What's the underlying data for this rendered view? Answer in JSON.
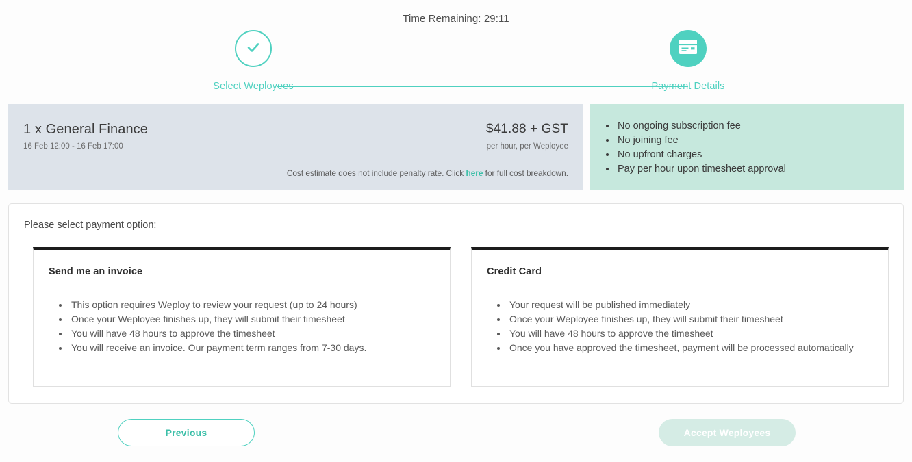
{
  "timer": {
    "label": "Time Remaining: 29:11"
  },
  "stepper": {
    "steps": [
      {
        "label": "Select Weployees",
        "state": "completed",
        "icon": "check-icon"
      },
      {
        "label": "Payment Details",
        "state": "active",
        "icon": "credit-card-icon"
      }
    ]
  },
  "summary": {
    "job_title": "1 x General Finance",
    "job_dates": "16 Feb 12:00 - 16 Feb 17:00",
    "price": "$41.88 + GST",
    "price_sub": "per hour, per Weployee",
    "cost_note_before": "Cost estimate does not include penalty rate. Click ",
    "cost_note_link": "here",
    "cost_note_after": " for full cost breakdown."
  },
  "benefits": {
    "items": [
      "No ongoing subscription fee",
      "No joining fee",
      "No upfront charges",
      "Pay per hour upon timesheet approval"
    ]
  },
  "options": {
    "prompt": "Please select payment option:",
    "cards": [
      {
        "title": "Send me an invoice",
        "bullets": [
          "This option requires Weploy to review your request (up to 24 hours)",
          "Once your Weployee finishes up, they will submit their timesheet",
          "You will have 48 hours to approve the timesheet",
          "You will receive an invoice. Our payment term ranges from 7-30 days."
        ]
      },
      {
        "title": "Credit Card",
        "bullets": [
          "Your request will be published immediately",
          "Once your Weployee finishes up, they will submit their timesheet",
          "You will have 48 hours to approve the timesheet",
          "Once you have approved the timesheet, payment will be processed automatically"
        ]
      }
    ]
  },
  "footer": {
    "previous_label": "Previous",
    "accept_label": "Accept Weployees"
  },
  "colors": {
    "teal": "#4fd1c0",
    "teal_text": "#3cbfa8",
    "summary_bg": "#dde3ea",
    "benefits_bg": "#c6e8dd",
    "disabled_btn": "#d5ece5",
    "card_top_border": "#1c1c1c"
  }
}
